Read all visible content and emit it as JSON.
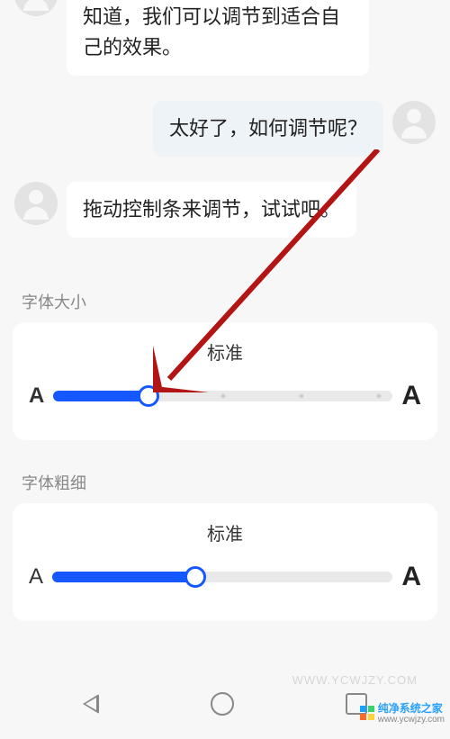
{
  "chat": {
    "messages": [
      {
        "side": "left",
        "text": "知道，我们可以调节到适合自己的效果。"
      },
      {
        "side": "right",
        "text": "太好了，如何调节呢？"
      },
      {
        "side": "left",
        "text": "拖动控制条来调节，试试吧。"
      }
    ]
  },
  "font_size": {
    "section_label": "字体大小",
    "value_label": "标准",
    "small_letter": "A",
    "big_letter": "A",
    "percent": 28,
    "ticks_percent": [
      50,
      73,
      96
    ]
  },
  "font_weight": {
    "section_label": "字体粗细",
    "value_label": "标准",
    "small_letter": "A",
    "big_letter": "A",
    "percent": 42
  },
  "annotation": {
    "arrow_color": "#b31414"
  },
  "watermark": {
    "bg_text": "WWW.YCWJZY.COM",
    "brand": "纯净系统之家",
    "url": "www.ycwjzy.com"
  }
}
